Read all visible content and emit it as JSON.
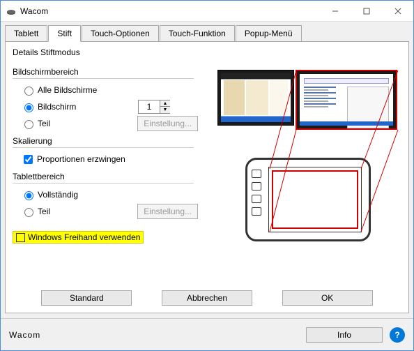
{
  "window": {
    "title": "Wacom"
  },
  "tabs": [
    {
      "label": "Tablett",
      "active": false
    },
    {
      "label": "Stift",
      "active": true
    },
    {
      "label": "Touch-Optionen",
      "active": false
    },
    {
      "label": "Touch-Funktion",
      "active": false
    },
    {
      "label": "Popup-Menü",
      "active": false
    }
  ],
  "panel": {
    "title": "Details Stiftmodus",
    "screen_area": {
      "label": "Bildschirmbereich",
      "opt_all": "Alle Bildschirme",
      "opt_screen": "Bildschirm",
      "opt_portion": "Teil",
      "screen_number": "1",
      "settings_btn": "Einstellung..."
    },
    "scaling": {
      "label": "Skalierung",
      "force_proportions": "Proportionen erzwingen"
    },
    "tablet_area": {
      "label": "Tablettbereich",
      "opt_full": "Vollständig",
      "opt_portion": "Teil",
      "settings_btn": "Einstellung..."
    },
    "windows_ink": "Windows Freihand verwenden",
    "buttons": {
      "default": "Standard",
      "cancel": "Abbrechen",
      "ok": "OK"
    }
  },
  "footer": {
    "logo": "Wacom",
    "info": "Info",
    "help": "?"
  }
}
